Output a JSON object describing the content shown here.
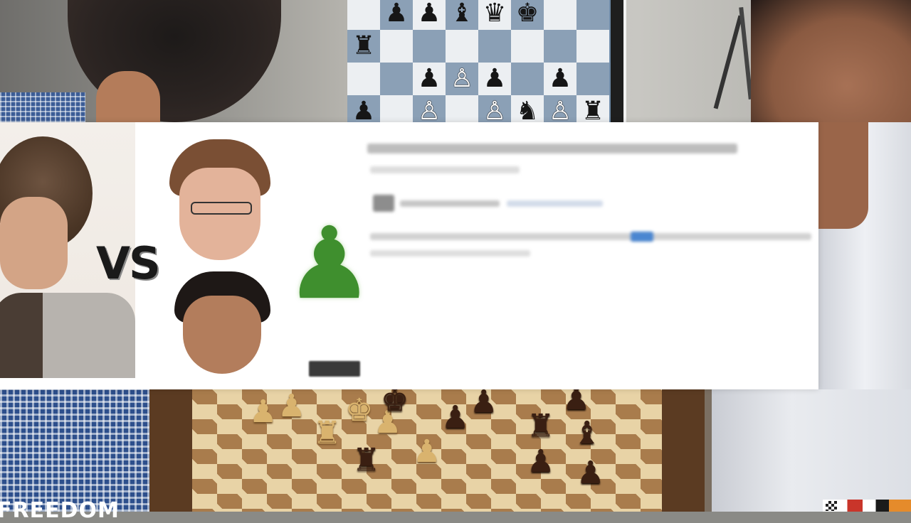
{
  "overlay": {
    "vs_text": "VS"
  },
  "watermark": {
    "text": "FREEDOM"
  },
  "digital_board": {
    "rows": [
      [
        {
          "p": "",
          "c": ""
        },
        {
          "p": "♟",
          "c": "b"
        },
        {
          "p": "♟",
          "c": "b"
        },
        {
          "p": "♝",
          "c": "b"
        },
        {
          "p": "♛",
          "c": "b"
        },
        {
          "p": "♚",
          "c": "b"
        },
        {
          "p": "",
          "c": ""
        },
        {
          "p": "",
          "c": ""
        }
      ],
      [
        {
          "p": "♜",
          "c": "b"
        },
        {
          "p": "",
          "c": ""
        },
        {
          "p": "",
          "c": ""
        },
        {
          "p": "",
          "c": ""
        },
        {
          "p": "",
          "c": ""
        },
        {
          "p": "",
          "c": ""
        },
        {
          "p": "",
          "c": ""
        },
        {
          "p": "",
          "c": ""
        }
      ],
      [
        {
          "p": "",
          "c": ""
        },
        {
          "p": "",
          "c": ""
        },
        {
          "p": "♟",
          "c": "b"
        },
        {
          "p": "♙",
          "c": "w"
        },
        {
          "p": "♟",
          "c": "b"
        },
        {
          "p": "",
          "c": ""
        },
        {
          "p": "♟",
          "c": "b"
        },
        {
          "p": "",
          "c": ""
        }
      ],
      [
        {
          "p": "♟",
          "c": "b"
        },
        {
          "p": "",
          "c": ""
        },
        {
          "p": "♙",
          "c": "w"
        },
        {
          "p": "",
          "c": ""
        },
        {
          "p": "♙",
          "c": "w"
        },
        {
          "p": "♞",
          "c": "b"
        },
        {
          "p": "♙",
          "c": "w"
        },
        {
          "p": "♜",
          "c": "b"
        }
      ]
    ]
  },
  "colors": {
    "overlay_bg": "#ffffff",
    "pawn_green": "#3f8f2e",
    "board_light": "#eceff2",
    "board_dark": "#8ba0b6"
  },
  "icons": [
    "green-pawn-icon",
    "chess-logo-icon"
  ]
}
